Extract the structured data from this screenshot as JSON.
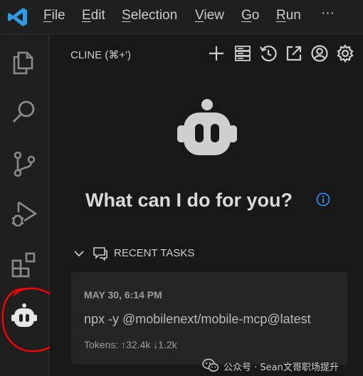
{
  "menubar": {
    "items": [
      {
        "accel": "F",
        "rest": "ile"
      },
      {
        "accel": "E",
        "rest": "dit"
      },
      {
        "accel": "S",
        "rest": "election"
      },
      {
        "accel": "V",
        "rest": "iew"
      },
      {
        "accel": "G",
        "rest": "o"
      },
      {
        "accel": "R",
        "rest": "un"
      }
    ],
    "more": "···"
  },
  "panel": {
    "title": "CLINE (⌘+')",
    "toolbar_icons": [
      "plus-icon",
      "server-icon",
      "history-icon",
      "popout-icon",
      "account-icon",
      "gear-icon"
    ]
  },
  "welcome": {
    "headline": "What can I do for you?"
  },
  "recent": {
    "label": "RECENT TASKS",
    "tasks": [
      {
        "date": "MAY 30, 6:14 PM",
        "text": "npx -y @mobilenext/mobile-mcp@latest",
        "tokens": "Tokens: ↑32.4k ↓1.2k"
      }
    ]
  },
  "watermark": {
    "text": "公众号 · Sean文哥职场提升"
  },
  "colors": {
    "annotation": "#ff0000",
    "vscode_blue": "#2f9ae0",
    "info_blue": "#3794ff",
    "icon_gray": "#cccccc"
  }
}
